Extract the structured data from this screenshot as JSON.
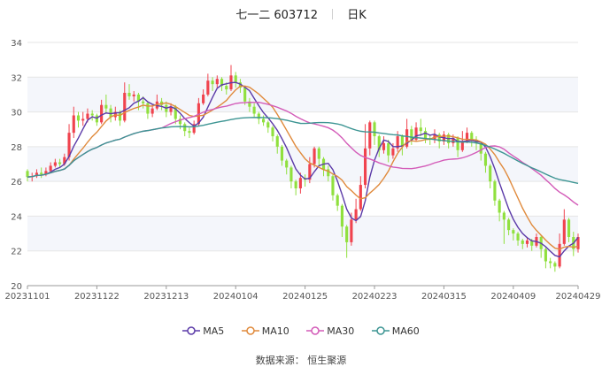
{
  "header": {
    "stock_name": "七一二",
    "stock_code": "603712",
    "period": "日K"
  },
  "source_text": "数据来源：  恒生聚源",
  "colors": {
    "up": "#f0434e",
    "down": "#90e03e",
    "MA5": "#5b3aa8",
    "MA10": "#e08a3c",
    "MA30": "#d35bb8",
    "MA60": "#3d9593"
  },
  "chart_data": {
    "type": "candlestick",
    "title": "七一二 603712",
    "period": "日K",
    "ylim": [
      20,
      34
    ],
    "yticks": [
      20,
      22,
      24,
      26,
      28,
      30,
      32,
      34
    ],
    "grid": true,
    "legend_position": "bottom",
    "x_tick_labels": [
      "20231101",
      "20231122",
      "20231213",
      "20240104",
      "20240125",
      "20240223",
      "20240315",
      "20240409",
      "20240429"
    ],
    "x_tick_indices": [
      0,
      15,
      30,
      45,
      60,
      75,
      90,
      105,
      119
    ],
    "ma_labels": [
      "MA5",
      "MA10",
      "MA30",
      "MA60"
    ],
    "candles": [
      [
        26.6,
        26.25,
        26.7,
        26.0
      ],
      [
        26.25,
        26.3,
        26.5,
        26.0
      ],
      [
        26.3,
        26.5,
        26.7,
        26.2
      ],
      [
        26.5,
        26.4,
        26.8,
        26.2
      ],
      [
        26.4,
        26.6,
        26.8,
        26.3
      ],
      [
        26.6,
        26.9,
        27.1,
        26.5
      ],
      [
        26.9,
        27.1,
        27.3,
        26.8
      ],
      [
        27.1,
        27.0,
        27.3,
        26.8
      ],
      [
        27.0,
        27.4,
        27.6,
        26.9
      ],
      [
        27.4,
        28.8,
        29.3,
        27.2
      ],
      [
        28.8,
        29.8,
        30.3,
        28.5
      ],
      [
        29.8,
        29.5,
        30.0,
        29.1
      ],
      [
        29.5,
        29.6,
        30.0,
        29.2
      ],
      [
        29.6,
        29.9,
        30.2,
        29.4
      ],
      [
        29.9,
        29.8,
        30.1,
        29.5
      ],
      [
        29.8,
        29.4,
        29.9,
        29.2
      ],
      [
        29.4,
        30.4,
        30.7,
        29.3
      ],
      [
        30.4,
        30.2,
        31.0,
        29.9
      ],
      [
        30.2,
        29.7,
        30.4,
        29.4
      ],
      [
        29.7,
        30.0,
        30.3,
        29.5
      ],
      [
        30.0,
        29.5,
        30.1,
        29.2
      ],
      [
        29.5,
        31.1,
        31.7,
        29.4
      ],
      [
        31.1,
        30.9,
        31.6,
        30.7
      ],
      [
        30.9,
        31.0,
        31.2,
        30.6
      ],
      [
        31.0,
        30.6,
        31.1,
        30.1
      ],
      [
        30.6,
        30.5,
        30.9,
        30.2
      ],
      [
        30.5,
        29.9,
        30.6,
        29.6
      ],
      [
        29.9,
        30.2,
        30.4,
        29.7
      ],
      [
        30.2,
        30.6,
        31.0,
        30.1
      ],
      [
        30.6,
        30.4,
        30.8,
        30.1
      ],
      [
        30.4,
        30.0,
        30.6,
        29.7
      ],
      [
        30.0,
        30.3,
        30.5,
        29.8
      ],
      [
        30.3,
        29.6,
        30.4,
        29.3
      ],
      [
        29.6,
        29.3,
        29.8,
        29.0
      ],
      [
        29.3,
        28.9,
        29.4,
        28.6
      ],
      [
        28.9,
        28.8,
        29.1,
        28.5
      ],
      [
        28.8,
        29.3,
        29.5,
        28.7
      ],
      [
        29.3,
        30.5,
        30.8,
        29.2
      ],
      [
        30.5,
        31.0,
        31.3,
        30.4
      ],
      [
        31.0,
        31.8,
        32.2,
        30.9
      ],
      [
        31.8,
        31.6,
        32.0,
        31.2
      ],
      [
        31.6,
        31.9,
        32.1,
        31.4
      ],
      [
        31.9,
        31.5,
        32.0,
        31.2
      ],
      [
        31.5,
        31.3,
        31.7,
        31.0
      ],
      [
        31.3,
        32.1,
        32.7,
        31.2
      ],
      [
        32.1,
        31.7,
        32.3,
        31.4
      ],
      [
        31.7,
        31.4,
        31.9,
        31.1
      ],
      [
        31.4,
        30.6,
        31.5,
        30.4
      ],
      [
        30.6,
        30.3,
        30.8,
        30.0
      ],
      [
        30.3,
        29.9,
        30.5,
        29.7
      ],
      [
        29.9,
        29.6,
        30.0,
        29.3
      ],
      [
        29.6,
        29.4,
        29.8,
        29.2
      ],
      [
        29.4,
        29.1,
        29.5,
        28.8
      ],
      [
        29.1,
        28.6,
        29.2,
        28.3
      ],
      [
        28.6,
        28.0,
        28.7,
        27.6
      ],
      [
        28.0,
        27.2,
        28.1,
        26.9
      ],
      [
        27.2,
        26.8,
        27.3,
        26.4
      ],
      [
        26.8,
        26.0,
        26.9,
        25.6
      ],
      [
        26.0,
        25.6,
        26.1,
        25.2
      ],
      [
        25.6,
        26.2,
        26.5,
        25.3
      ],
      [
        26.2,
        26.1,
        26.4,
        25.7
      ],
      [
        26.1,
        27.0,
        27.4,
        25.9
      ],
      [
        27.0,
        27.9,
        28.0,
        26.8
      ],
      [
        27.9,
        27.3,
        28.0,
        26.9
      ],
      [
        27.3,
        26.7,
        27.4,
        26.3
      ],
      [
        26.7,
        26.3,
        26.9,
        26.0
      ],
      [
        26.3,
        25.2,
        26.4,
        24.9
      ],
      [
        25.2,
        24.6,
        25.3,
        24.3
      ],
      [
        24.6,
        23.4,
        24.7,
        22.8
      ],
      [
        23.4,
        22.5,
        23.5,
        21.6
      ],
      [
        22.5,
        23.8,
        24.2,
        22.3
      ],
      [
        23.8,
        24.4,
        25.0,
        23.6
      ],
      [
        24.4,
        25.8,
        26.3,
        24.3
      ],
      [
        25.8,
        27.9,
        29.3,
        25.6
      ],
      [
        27.9,
        29.4,
        29.5,
        27.5
      ],
      [
        29.4,
        28.6,
        29.5,
        28.1
      ],
      [
        28.6,
        27.8,
        28.7,
        27.4
      ],
      [
        27.8,
        28.2,
        28.6,
        27.6
      ],
      [
        28.2,
        27.5,
        28.4,
        27.1
      ],
      [
        27.5,
        27.9,
        28.2,
        27.3
      ],
      [
        27.9,
        28.6,
        28.9,
        27.7
      ],
      [
        28.6,
        28.0,
        28.7,
        27.5
      ],
      [
        28.0,
        29.0,
        29.6,
        27.9
      ],
      [
        29.0,
        28.4,
        29.2,
        28.1
      ],
      [
        28.4,
        29.1,
        29.4,
        28.3
      ],
      [
        29.1,
        28.9,
        29.6,
        28.6
      ],
      [
        28.9,
        28.5,
        29.1,
        28.2
      ],
      [
        28.5,
        28.4,
        28.7,
        28.1
      ],
      [
        28.4,
        28.7,
        29.0,
        28.2
      ],
      [
        28.7,
        28.3,
        28.8,
        27.9
      ],
      [
        28.3,
        28.7,
        28.9,
        28.1
      ],
      [
        28.7,
        28.2,
        28.8,
        27.9
      ],
      [
        28.2,
        28.5,
        28.7,
        28.0
      ],
      [
        28.5,
        27.8,
        28.6,
        27.4
      ],
      [
        27.8,
        28.3,
        28.9,
        27.7
      ],
      [
        28.3,
        28.8,
        29.1,
        28.2
      ],
      [
        28.8,
        28.4,
        28.9,
        28.0
      ],
      [
        28.4,
        28.2,
        28.6,
        27.8
      ],
      [
        28.2,
        27.6,
        28.3,
        27.2
      ],
      [
        27.6,
        26.9,
        27.7,
        26.5
      ],
      [
        26.9,
        26.0,
        27.0,
        25.6
      ],
      [
        26.0,
        24.9,
        26.1,
        24.6
      ],
      [
        24.9,
        24.2,
        25.0,
        23.7
      ],
      [
        24.2,
        23.8,
        24.3,
        22.4
      ],
      [
        23.8,
        23.2,
        23.9,
        22.9
      ],
      [
        23.2,
        23.0,
        23.3,
        22.6
      ],
      [
        23.0,
        22.6,
        23.1,
        22.3
      ],
      [
        22.6,
        22.4,
        22.7,
        22.1
      ],
      [
        22.4,
        22.6,
        22.8,
        22.2
      ],
      [
        22.6,
        22.3,
        22.7,
        22.0
      ],
      [
        22.3,
        22.8,
        23.0,
        22.2
      ],
      [
        22.8,
        22.1,
        22.9,
        21.6
      ],
      [
        22.1,
        21.4,
        22.2,
        21.0
      ],
      [
        21.4,
        21.3,
        21.6,
        21.0
      ],
      [
        21.3,
        21.1,
        21.4,
        20.8
      ],
      [
        21.1,
        22.4,
        23.0,
        21.0
      ],
      [
        22.4,
        23.8,
        24.4,
        22.3
      ],
      [
        23.8,
        22.8,
        23.9,
        22.5
      ],
      [
        22.8,
        22.1,
        23.1,
        21.7
      ],
      [
        22.1,
        22.8,
        23.0,
        21.9
      ]
    ]
  }
}
